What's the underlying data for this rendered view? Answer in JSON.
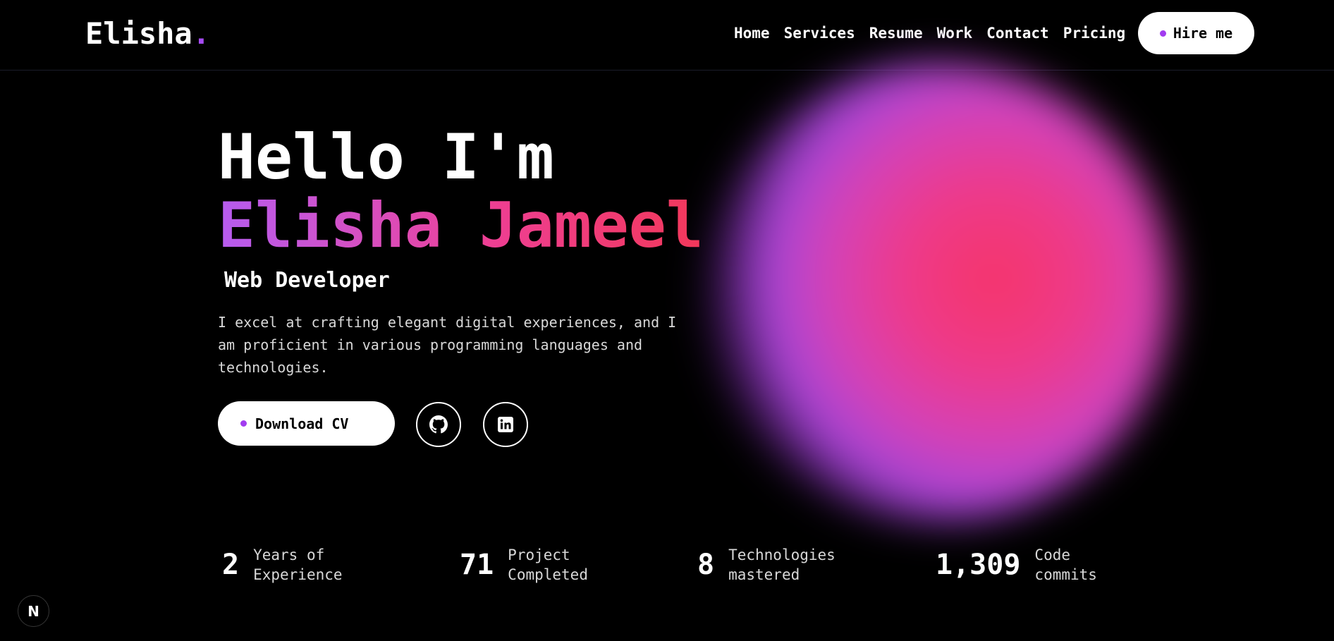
{
  "header": {
    "logo_text": "Elisha",
    "logo_dot": ".",
    "nav": [
      "Home",
      "Services",
      "Resume",
      "Work",
      "Contact",
      "Pricing"
    ],
    "hire_label": "Hire me"
  },
  "hero": {
    "greeting": "Hello I'm",
    "name": "Elisha Jameel",
    "role": "Web Developer",
    "description": "I excel at crafting elegant digital experiences, and I am proficient in various programming languages and technologies.",
    "cv_label": "Download CV",
    "social": [
      {
        "name": "github-icon"
      },
      {
        "name": "linkedin-icon"
      }
    ]
  },
  "stats": [
    {
      "value": "2",
      "label_line1": "Years of",
      "label_line2": "Experience"
    },
    {
      "value": "71",
      "label_line1": "Project",
      "label_line2": "Completed"
    },
    {
      "value": "8",
      "label_line1": "Technologies",
      "label_line2": "mastered"
    },
    {
      "value": "1,309",
      "label_line1": "Code",
      "label_line2": "commits"
    }
  ],
  "badge": {
    "text": "N"
  },
  "colors": {
    "accent": "#a64bf4",
    "gradient_start": "#b65cf0",
    "gradient_end": "#f2385a",
    "background": "#000000"
  }
}
